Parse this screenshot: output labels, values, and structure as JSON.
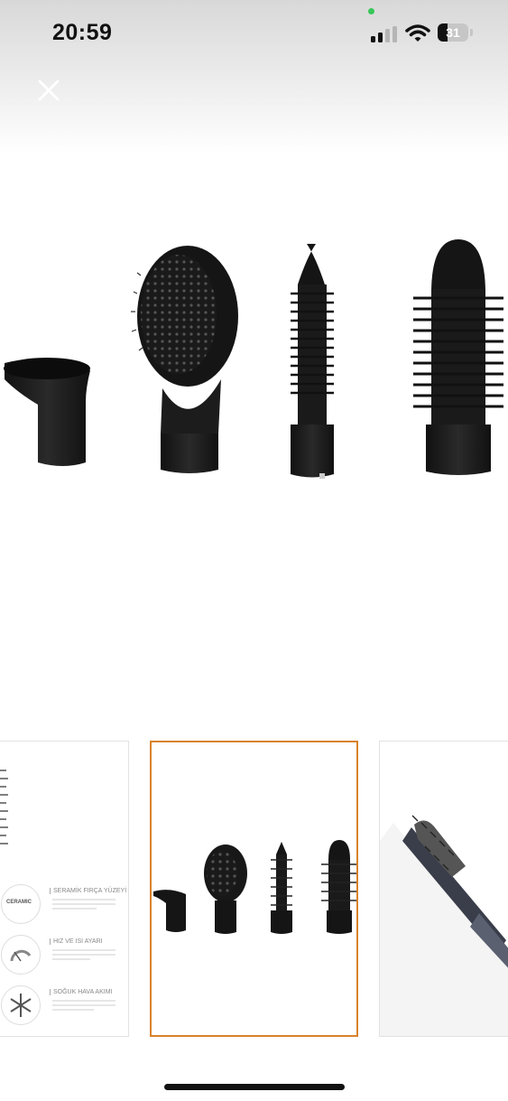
{
  "status_bar": {
    "time": "20:59",
    "battery_level": 31,
    "battery_label": "31",
    "icons": [
      "cellular-signal-icon",
      "wifi-icon",
      "battery-icon"
    ]
  },
  "toolbar": {
    "close_icon": "close-icon"
  },
  "gallery": {
    "selected_index": 1,
    "accent_color": "#d9822b",
    "thumbnails": [
      {
        "features": [
          {
            "title": "SERAMİK FIRÇA YÜZEYİ",
            "badge": "CERAMIC"
          },
          {
            "title": "HIZ VE ISI AYARI"
          },
          {
            "title": "SOĞUK HAVA AKIMI"
          }
        ]
      },
      {},
      {}
    ]
  }
}
